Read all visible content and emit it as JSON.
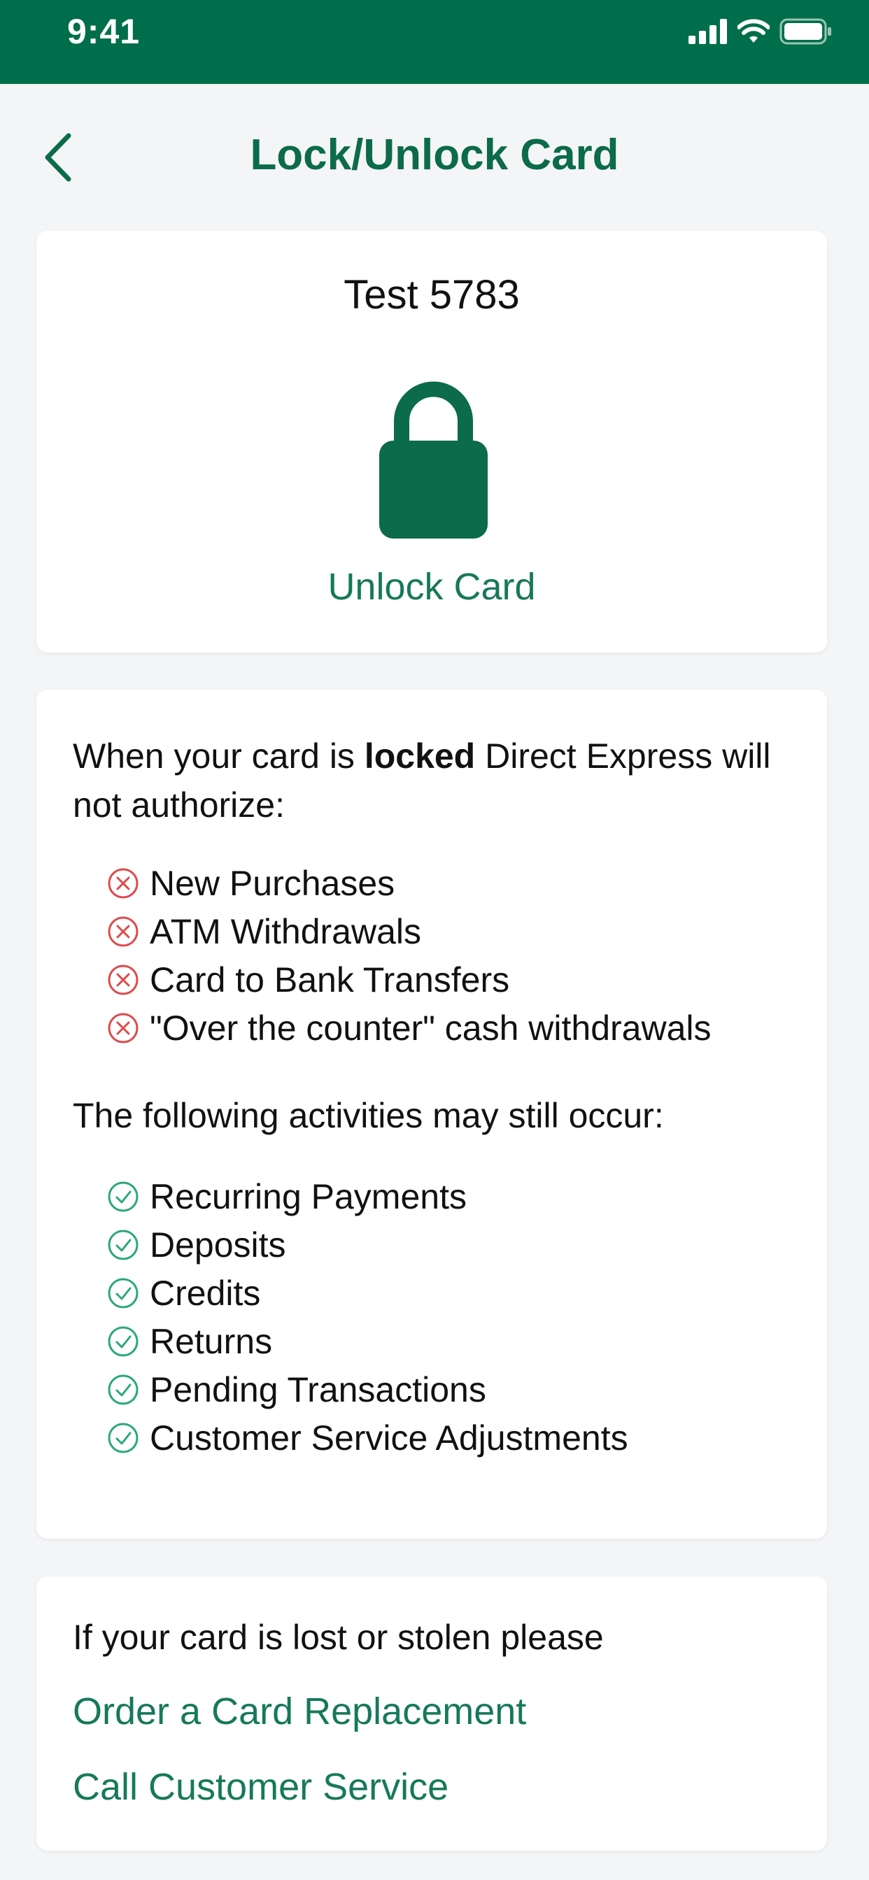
{
  "status_bar": {
    "time": "9:41"
  },
  "header": {
    "title": "Lock/Unlock Card"
  },
  "card": {
    "name": "Test 5783",
    "unlock_label": "Unlock Card"
  },
  "info": {
    "locked_prefix": "When your card is ",
    "locked_bold": "locked",
    "locked_suffix": " Direct Express will not authorize:",
    "blocked": [
      "New Purchases",
      "ATM Withdrawals",
      "Card to Bank Transfers",
      "\"Over the counter\" cash withdrawals"
    ],
    "allowed_intro": "The following activities may still occur:",
    "allowed": [
      "Recurring Payments",
      "Deposits",
      "Credits",
      "Returns",
      "Pending Transactions",
      "Customer Service Adjustments"
    ]
  },
  "lost": {
    "text": "If your card is lost or stolen please",
    "order_link": "Order a Card Replacement",
    "call_link": "Call Customer Service"
  },
  "colors": {
    "brand_green": "#006e4a",
    "link_green": "#16795a",
    "blocked_red": "#e04a4a",
    "allowed_green": "#2aa87a"
  },
  "icons": {
    "blocked": "x-circle-icon",
    "allowed": "check-circle-icon",
    "lock": "lock-icon",
    "back": "chevron-left-icon"
  }
}
